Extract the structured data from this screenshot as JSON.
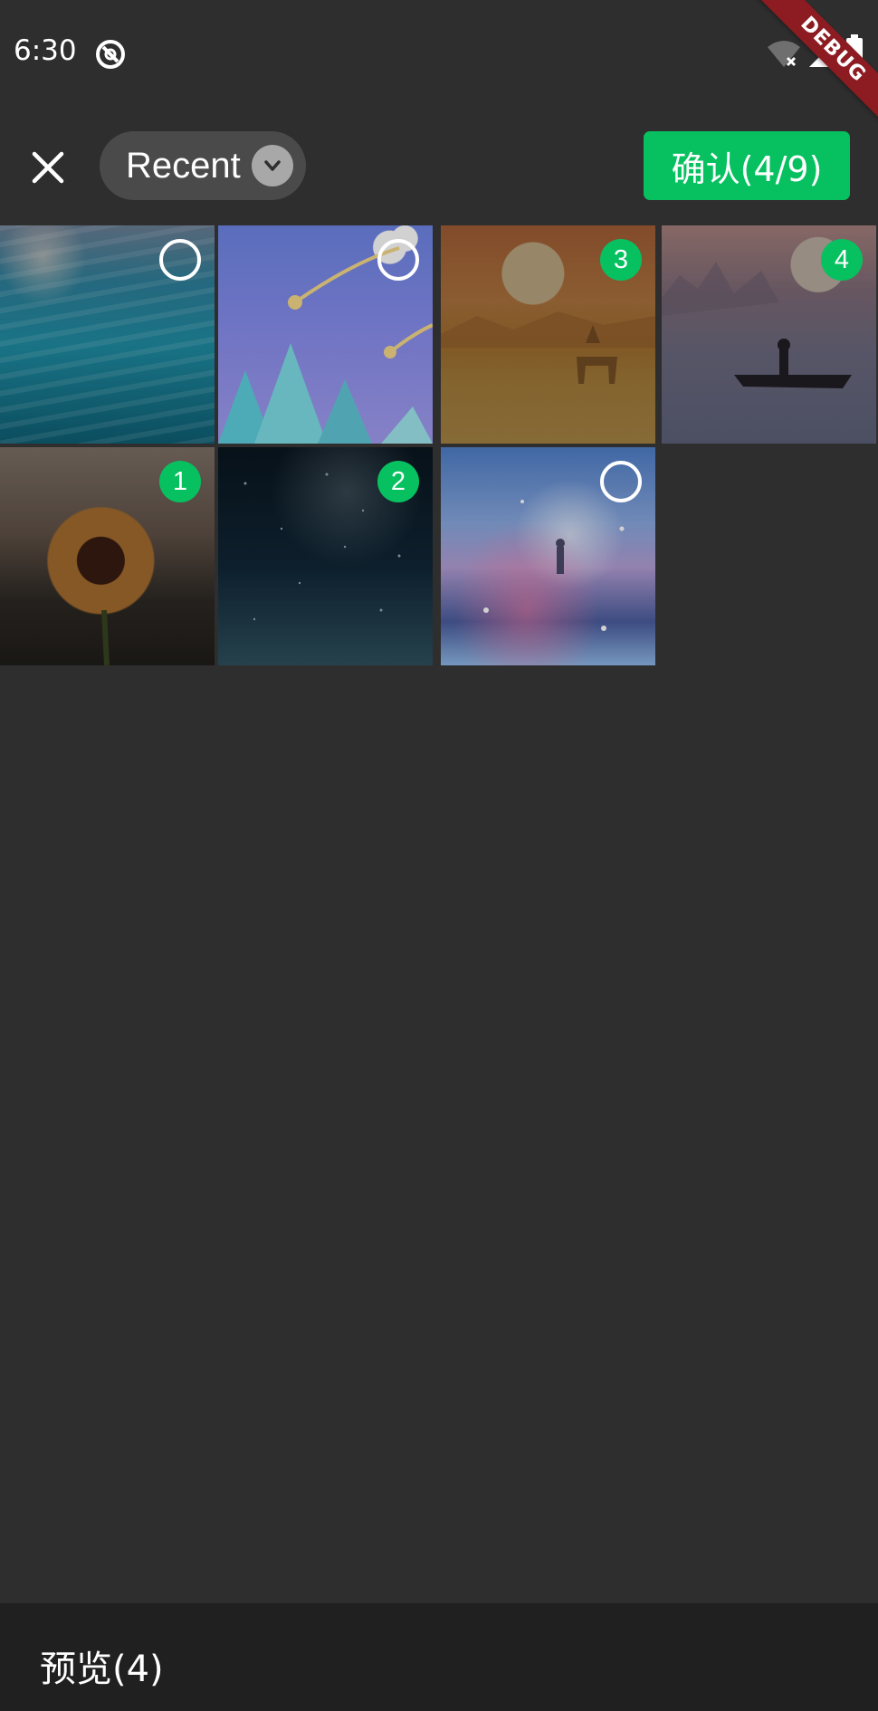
{
  "status_bar": {
    "time": "6:30",
    "debug_label": "DEBUG"
  },
  "top_bar": {
    "album_label": "Recent",
    "confirm_label": "确认(4/9)"
  },
  "grid": {
    "tiles": [
      {
        "image": "ocean underwater",
        "selected": false,
        "order": ""
      },
      {
        "image": "shooting stars over trees",
        "selected": false,
        "order": ""
      },
      {
        "image": "deer at sunset",
        "selected": true,
        "order": "3"
      },
      {
        "image": "boat on misty lake",
        "selected": true,
        "order": "4"
      },
      {
        "image": "sunflower",
        "selected": true,
        "order": "1"
      },
      {
        "image": "night starry sky",
        "selected": true,
        "order": "2"
      },
      {
        "image": "galaxy anime sky",
        "selected": false,
        "order": ""
      }
    ]
  },
  "bottom_bar": {
    "preview_label": "预览(4)"
  },
  "colors": {
    "accent": "#07c160",
    "background": "#2e2e2e",
    "bottom_bar": "#202020",
    "debug_ribbon": "#8d1c22"
  },
  "icons": [
    "close-icon",
    "chevron-down-icon",
    "wifi-icon",
    "signal-icon",
    "battery-icon",
    "app-status-icon"
  ]
}
